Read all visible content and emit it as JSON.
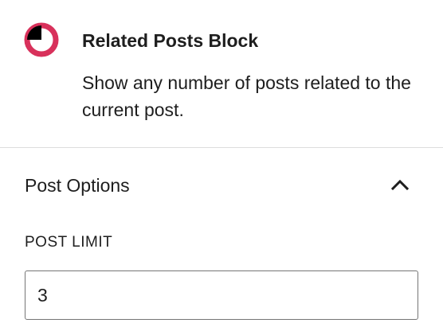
{
  "block": {
    "icon": "related-posts-ring-icon",
    "title": "Related Posts Block",
    "description": "Show any number of posts related to the current post."
  },
  "panel": {
    "title": "Post Options",
    "toggle_icon": "chevron-up-icon",
    "expanded": true
  },
  "post_limit": {
    "label": "POST LIMIT",
    "value": "3"
  },
  "colors": {
    "accent": "#d8315b",
    "text": "#1e1e1e",
    "divider": "#dddddd",
    "input_border": "#757575"
  }
}
